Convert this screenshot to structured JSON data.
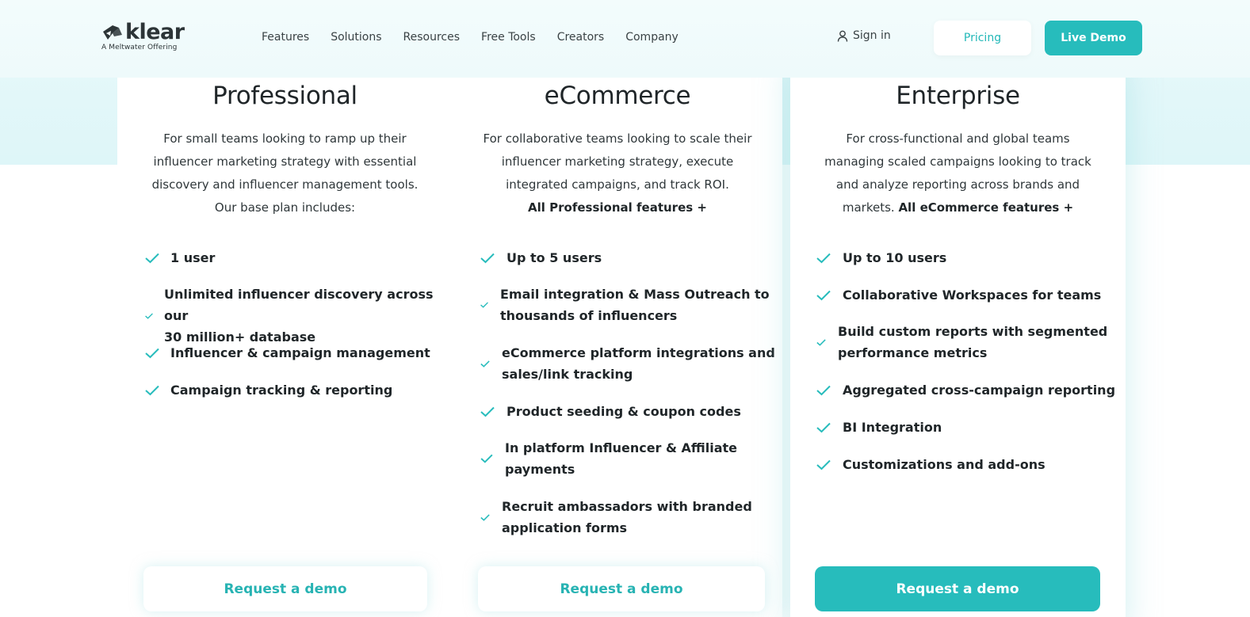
{
  "brand": {
    "name": "klear",
    "tagline": "A Meltwater Offering",
    "logo_icon": "klear-logo-icon"
  },
  "nav": {
    "items": [
      "Features",
      "Solutions",
      "Resources",
      "Free Tools",
      "Creators",
      "Company"
    ]
  },
  "header": {
    "signin_label": "Sign in",
    "pricing_label": "Pricing",
    "demo_label": "Live Demo"
  },
  "colors": {
    "accent": "#27bcbc",
    "text": "#1f2528",
    "band": "#e2f7f9"
  },
  "plans": [
    {
      "title": "Professional",
      "desc_lines": [
        "For small teams looking to ramp up their",
        "influencer marketing strategy with essential",
        "discovery and influencer management tools.",
        "Our base plan includes:"
      ],
      "desc_bold": "",
      "features": [
        [
          "1 user"
        ],
        [
          "Unlimited influencer discovery across our",
          "30 million+ database"
        ],
        [
          "Influencer & campaign management"
        ],
        [
          "Campaign tracking & reporting"
        ]
      ],
      "cta": "Request a demo"
    },
    {
      "title": "eCommerce",
      "desc_lines": [
        "For collaborative teams looking to scale their",
        "influencer marketing strategy, execute",
        "integrated campaigns, and track ROI."
      ],
      "desc_bold": "All Professional features +",
      "features": [
        [
          "Up to 5 users"
        ],
        [
          "Email integration & Mass Outreach to",
          "thousands of influencers"
        ],
        [
          "eCommerce platform integrations and",
          "sales/link tracking"
        ],
        [
          "Product seeding & coupon codes"
        ],
        [
          "In platform Influencer & Affiliate",
          "payments"
        ],
        [
          "Recruit ambassadors with branded",
          "application forms"
        ]
      ],
      "cta": "Request a demo"
    },
    {
      "title": "Enterprise",
      "desc_lines": [
        "For cross-functional and global teams",
        "managing scaled campaigns looking to track",
        "and analyze reporting across brands and"
      ],
      "desc_last_prefix": "markets. ",
      "desc_bold": "All eCommerce features +",
      "features": [
        [
          "Up to 10 users"
        ],
        [
          "Collaborative Workspaces for teams"
        ],
        [
          "Build custom reports with segmented",
          "performance metrics"
        ],
        [
          "Aggregated cross-campaign reporting"
        ],
        [
          "BI Integration"
        ],
        [
          "Customizations and add-ons"
        ]
      ],
      "cta": "Request a demo"
    }
  ]
}
